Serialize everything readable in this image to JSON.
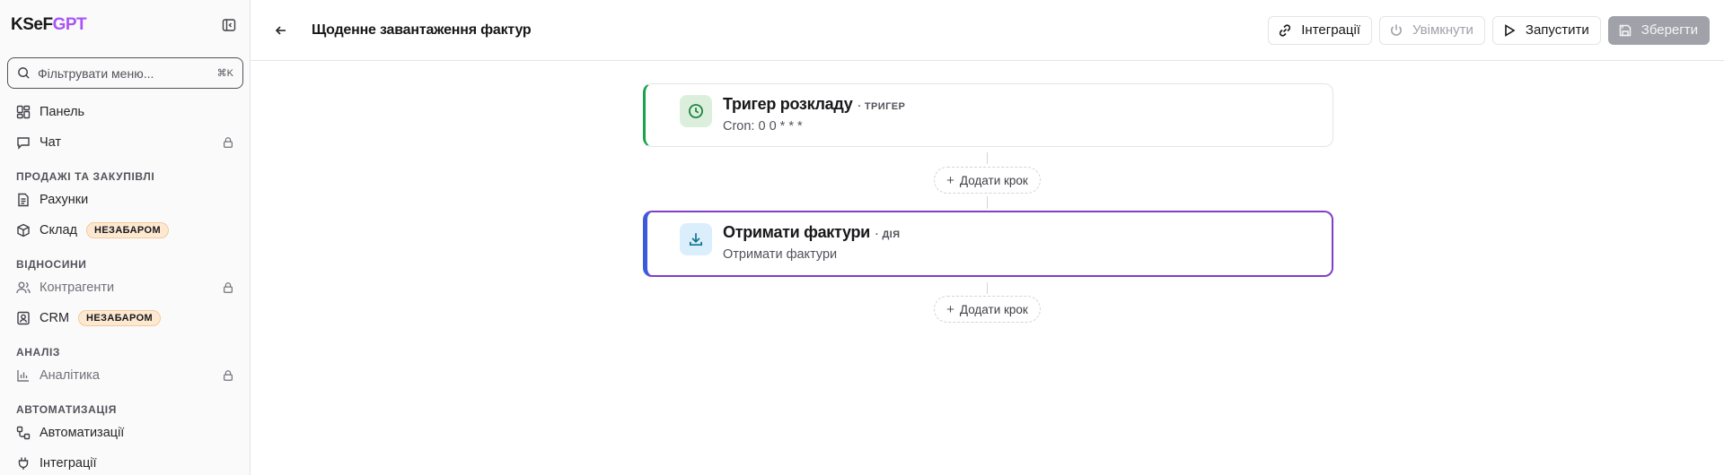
{
  "sidebar": {
    "brand_main": "KSeF",
    "brand_accent": "GPT",
    "filter_placeholder": "Фільтрувати меню...",
    "filter_shortcut": "⌘K",
    "items": [
      {
        "label": "Панель",
        "icon": "dashboard-icon"
      },
      {
        "label": "Чат",
        "icon": "chat-icon",
        "locked": true
      }
    ],
    "sections": [
      {
        "title": "ПРОДАЖІ ТА ЗАКУПІВЛІ",
        "items": [
          {
            "label": "Рахунки",
            "icon": "file-text-icon"
          },
          {
            "label": "Склад",
            "icon": "box-icon",
            "badge": "НЕЗАБАРОМ"
          }
        ]
      },
      {
        "title": "ВІДНОСИНИ",
        "items": [
          {
            "label": "Контрагенти",
            "icon": "users-icon",
            "locked": true
          },
          {
            "label": "CRM",
            "icon": "contact-icon",
            "badge": "НЕЗАБАРОМ"
          }
        ]
      },
      {
        "title": "АНАЛІЗ",
        "items": [
          {
            "label": "Аналітика",
            "icon": "chart-icon",
            "locked": true
          }
        ]
      },
      {
        "title": "АВТОМАТИЗАЦІЯ",
        "items": [
          {
            "label": "Автоматизації",
            "icon": "workflow-icon"
          },
          {
            "label": "Інтеграції",
            "icon": "plug-icon"
          }
        ]
      }
    ]
  },
  "header": {
    "title": "Щоденне завантаження фактур",
    "buttons": {
      "integrations": "Інтеграції",
      "enable": "Увімкнути",
      "run": "Запустити",
      "save": "Зберегти"
    }
  },
  "workflow": {
    "trigger": {
      "name": "Тригер розкладу",
      "type": "· ТРИГЕР",
      "subtitle": "Cron: 0 0 * * *",
      "icon": "clock-icon"
    },
    "action": {
      "name": "Отримати фактури",
      "type": "· ДІЯ",
      "subtitle": "Отримати фактури",
      "icon": "download-icon"
    },
    "add_step_label": "Додати крок"
  },
  "colors": {
    "brand_accent": "#a855f7",
    "trigger_accent": "#16a34a",
    "action_border": "#7e3fc7",
    "action_accent": "#3b5bdb",
    "badge_bg": "#fde9d2"
  }
}
